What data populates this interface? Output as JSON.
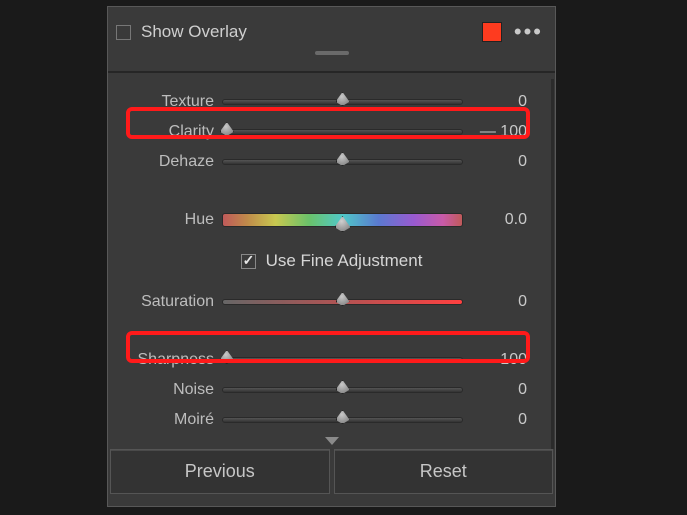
{
  "header": {
    "show_overlay_label": "Show Overlay",
    "swatch_color": "#fe3b1f"
  },
  "sliders": {
    "texture": {
      "label": "Texture",
      "value": "0",
      "pos": 50
    },
    "clarity": {
      "label": "Clarity",
      "value": "— 100",
      "pos": 1
    },
    "dehaze": {
      "label": "Dehaze",
      "value": "0",
      "pos": 50
    },
    "hue": {
      "label": "Hue",
      "value": "0.0"
    },
    "fine": {
      "label": "Use Fine Adjustment"
    },
    "saturation": {
      "label": "Saturation",
      "value": "0",
      "pos": 50
    },
    "sharpness": {
      "label": "Sharpness",
      "value": "— 100",
      "pos": 1
    },
    "noise": {
      "label": "Noise",
      "value": "0",
      "pos": 50
    },
    "moire": {
      "label": "Moiré",
      "value": "0",
      "pos": 50
    }
  },
  "footer": {
    "previous": "Previous",
    "reset": "Reset"
  }
}
